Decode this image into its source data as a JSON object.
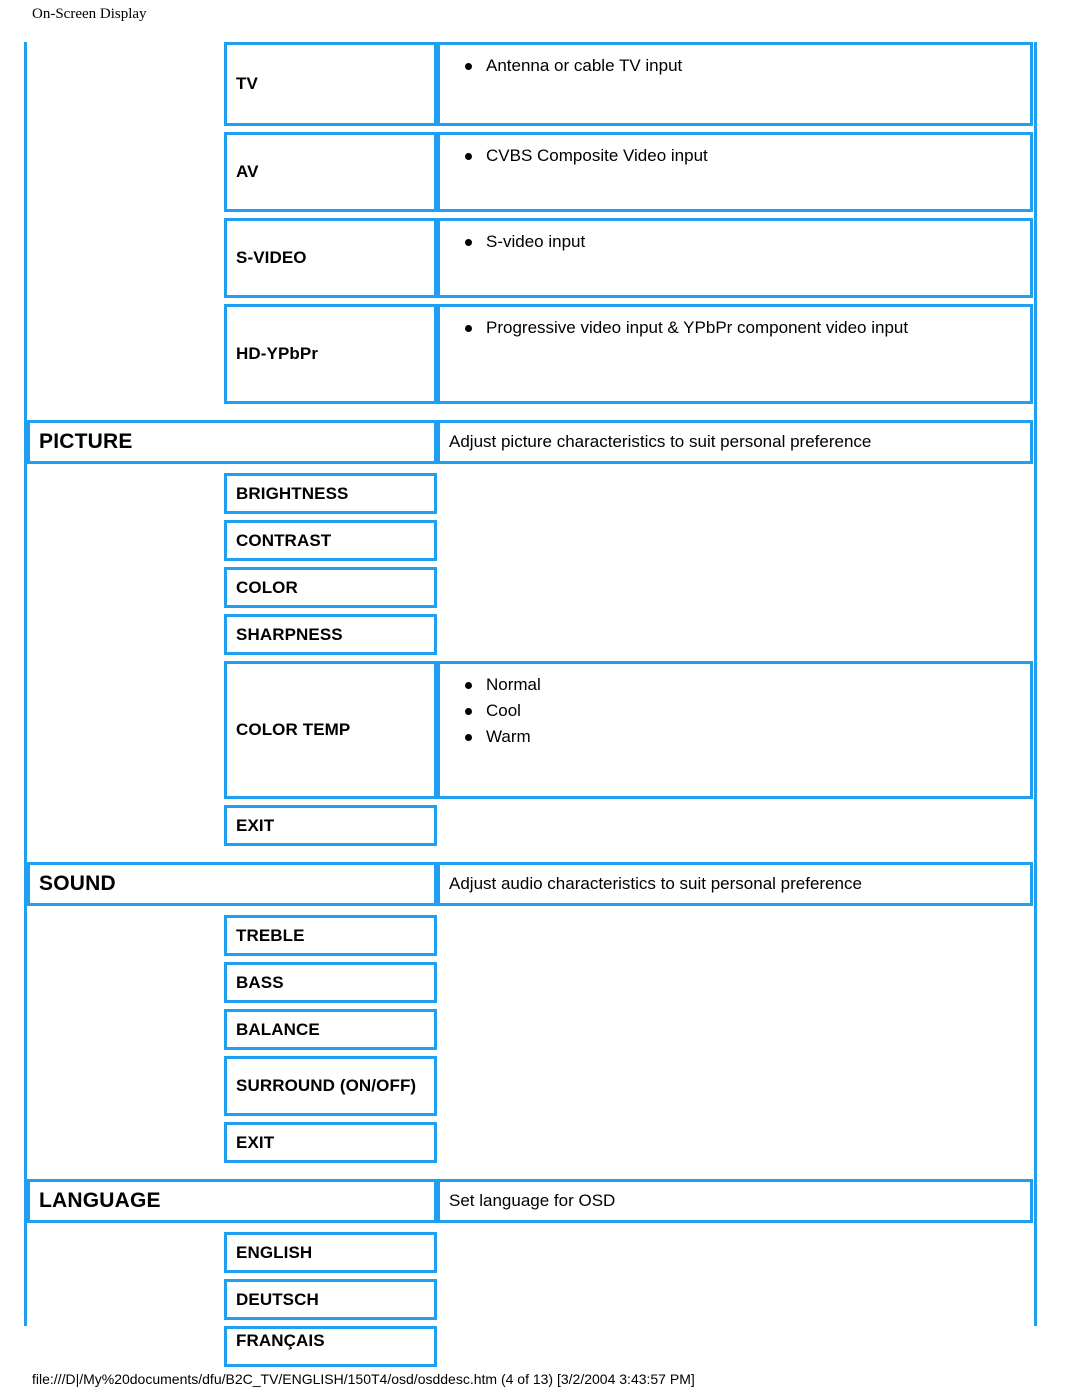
{
  "header": {
    "title": "On-Screen Display"
  },
  "footer": {
    "path": "file:///D|/My%20documents/dfu/B2C_TV/ENGLISH/150T4/osd/osddesc.htm (4 of 13) [3/2/2004 3:43:57 PM]"
  },
  "colors": {
    "border": "#1e9ff2",
    "text": "#000000",
    "background": "#ffffff"
  },
  "table": {
    "input_sources": [
      {
        "label": "TV",
        "bullets": [
          "Antenna or cable TV input"
        ]
      },
      {
        "label": "AV",
        "bullets": [
          "CVBS Composite Video input"
        ]
      },
      {
        "label": "S-VIDEO",
        "bullets": [
          "S-video input"
        ]
      },
      {
        "label": "HD-YPbPr",
        "bullets": [
          "Progressive video input & YPbPr component video input"
        ]
      }
    ],
    "sections": [
      {
        "name": "PICTURE",
        "description": "Adjust picture characteristics to suit personal preference",
        "items": [
          {
            "label": "BRIGHTNESS",
            "bullets": []
          },
          {
            "label": "CONTRAST",
            "bullets": []
          },
          {
            "label": "COLOR",
            "bullets": []
          },
          {
            "label": "SHARPNESS",
            "bullets": []
          },
          {
            "label": "COLOR TEMP",
            "bullets": [
              "Normal",
              "Cool",
              "Warm"
            ]
          },
          {
            "label": "EXIT",
            "bullets": []
          }
        ]
      },
      {
        "name": "SOUND",
        "description": "Adjust audio characteristics to suit personal preference",
        "items": [
          {
            "label": "TREBLE",
            "bullets": []
          },
          {
            "label": "BASS",
            "bullets": []
          },
          {
            "label": "BALANCE",
            "bullets": []
          },
          {
            "label": "SURROUND (ON/OFF)",
            "bullets": []
          },
          {
            "label": "EXIT",
            "bullets": []
          }
        ]
      },
      {
        "name": "LANGUAGE",
        "description": "Set language for OSD",
        "items": [
          {
            "label": "ENGLISH",
            "bullets": []
          },
          {
            "label": "DEUTSCH",
            "bullets": []
          },
          {
            "label": "FRANÇAIS",
            "bullets": []
          }
        ]
      }
    ]
  }
}
